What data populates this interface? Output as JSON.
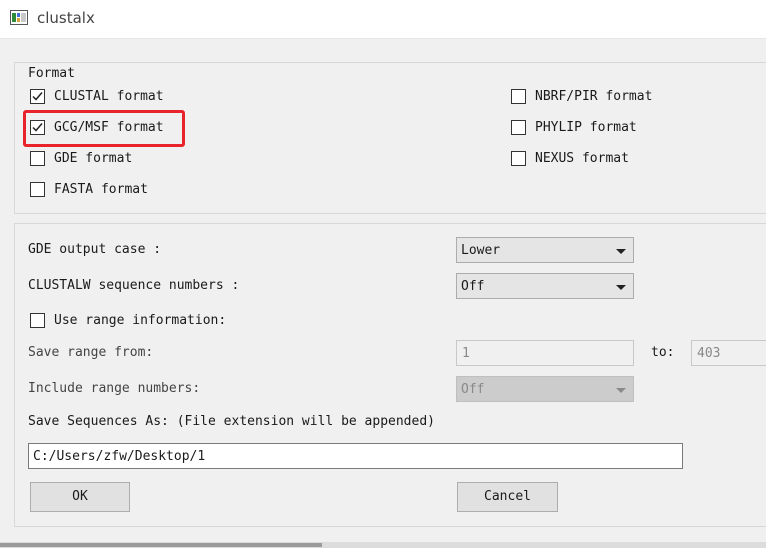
{
  "window": {
    "title": "clustalx"
  },
  "format_group": {
    "title": "Format",
    "options": [
      {
        "label": "CLUSTAL format",
        "checked": true
      },
      {
        "label": "GCG/MSF format",
        "checked": true
      },
      {
        "label": "GDE format",
        "checked": false
      },
      {
        "label": "FASTA format",
        "checked": false
      },
      {
        "label": "NBRF/PIR format",
        "checked": false
      },
      {
        "label": "PHYLIP format",
        "checked": false
      },
      {
        "label": "NEXUS format",
        "checked": false
      }
    ]
  },
  "output": {
    "gde_case": {
      "label": "GDE output case :",
      "value": "Lower"
    },
    "clustalw_seq_numbers": {
      "label": "CLUSTALW sequence numbers :",
      "value": "Off"
    },
    "use_range": {
      "label": "Use range information:",
      "checked": false
    },
    "save_range": {
      "label": "Save range from:",
      "from": "1",
      "to_label": "to:",
      "to": "403"
    },
    "include_range_numbers": {
      "label": "Include range numbers:",
      "value": "Off"
    },
    "save_as": {
      "label": "Save Sequences As: (File extension will be appended)",
      "value": "C:/Users/zfw/Desktop/1"
    }
  },
  "buttons": {
    "ok": "OK",
    "cancel": "Cancel"
  },
  "annotation": {
    "highlight_color": "#e8232b"
  }
}
